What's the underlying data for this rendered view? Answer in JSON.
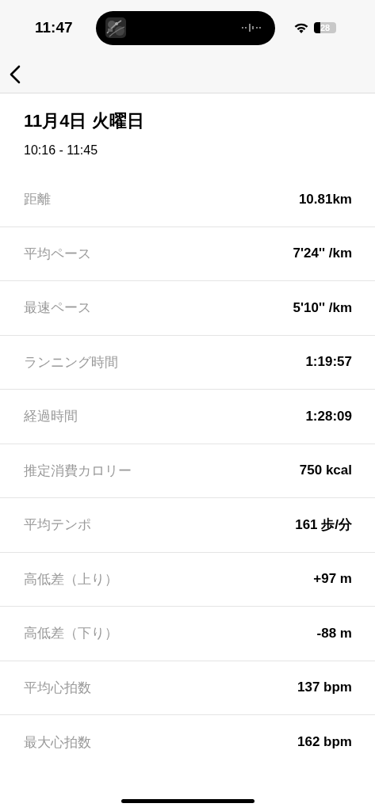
{
  "status_bar": {
    "time": "11:47",
    "battery": "28"
  },
  "header": {
    "title": "11月4日 火曜日",
    "time_range": "10:16 - 11:45"
  },
  "stats": [
    {
      "label": "距離",
      "value": "10.81km"
    },
    {
      "label": "平均ペース",
      "value": "7'24'' /km"
    },
    {
      "label": "最速ペース",
      "value": "5'10'' /km"
    },
    {
      "label": "ランニング時間",
      "value": "1:19:57"
    },
    {
      "label": "経過時間",
      "value": "1:28:09"
    },
    {
      "label": "推定消費カロリー",
      "value": "750 kcal"
    },
    {
      "label": "平均テンポ",
      "value": "161 歩/分"
    },
    {
      "label": "高低差（上り）",
      "value": "+97 m"
    },
    {
      "label": "高低差（下り）",
      "value": "-88 m"
    },
    {
      "label": "平均心拍数",
      "value": "137 bpm"
    },
    {
      "label": "最大心拍数",
      "value": "162 bpm"
    }
  ]
}
